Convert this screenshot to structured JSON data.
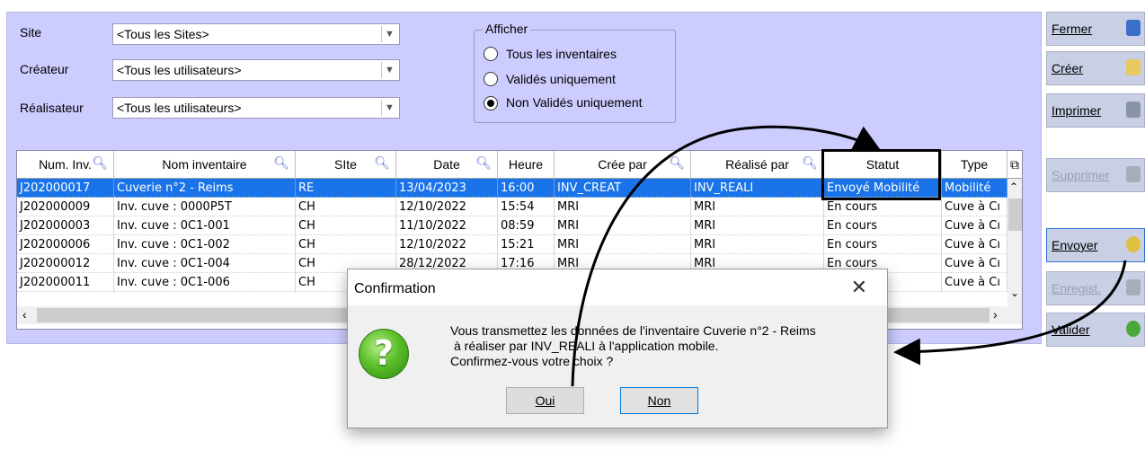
{
  "filters": {
    "site": {
      "label": "Site",
      "value": "<Tous les Sites>"
    },
    "createur": {
      "label": "Créateur",
      "value": "<Tous les utilisateurs>"
    },
    "realisateur": {
      "label": "Réalisateur",
      "value": "<Tous les utilisateurs>"
    }
  },
  "afficher": {
    "title": "Afficher",
    "options": [
      {
        "label": "Tous les inventaires",
        "selected": false
      },
      {
        "label": "Validés uniquement",
        "selected": false
      },
      {
        "label": "Non Validés uniquement",
        "selected": true
      }
    ]
  },
  "table": {
    "columns": [
      "Num. Inv.",
      "Nom inventaire",
      "SIte",
      "Date",
      "Heure",
      "Crée par",
      "Réalisé par",
      "Statut",
      "Type"
    ],
    "rows": [
      [
        "J202000017",
        "Cuverie n°2 - Reims",
        "RE",
        "13/04/2023",
        "16:00",
        "INV_CREAT",
        "INV_REALI",
        "Envoyé Mobilité",
        "Mobilité"
      ],
      [
        "J202000009",
        "Inv. cuve : 0000P5T",
        "CH",
        "12/10/2022",
        "15:54",
        "MRI",
        "MRI",
        "En cours",
        "Cuve à Cı"
      ],
      [
        "J202000003",
        "Inv. cuve : 0C1-001",
        "CH",
        "11/10/2022",
        "08:59",
        "MRI",
        "MRI",
        "En cours",
        "Cuve à Cı"
      ],
      [
        "J202000006",
        "Inv. cuve : 0C1-002",
        "CH",
        "12/10/2022",
        "15:21",
        "MRI",
        "MRI",
        "En cours",
        "Cuve à Cı"
      ],
      [
        "J202000012",
        "Inv. cuve : 0C1-004",
        "CH",
        "28/12/2022",
        "17:16",
        "MRI",
        "MRI",
        "En cours",
        "Cuve à Cı"
      ],
      [
        "J202000011",
        "Inv. cuve : 0C1-006",
        "CH",
        "",
        "",
        "",
        "",
        "",
        "Cuve à Cı"
      ]
    ],
    "selected_row": 0,
    "highlight_column": "Statut"
  },
  "buttons": {
    "fermer": "Fermer",
    "creer": "Créer",
    "imprimer": "Imprimer",
    "supprimer": "Supprimer",
    "envoyer": "Envoyer",
    "enregistrer": "Enregist.",
    "valider": "Valider"
  },
  "dialog": {
    "title": "Confirmation",
    "line1": "Vous transmettez les données de l'inventaire Cuverie n°2 - Reims",
    "line2": "à réaliser par INV_REALI à l'application mobile.",
    "line3": "Confirmez-vous votre choix ?",
    "yes": "Oui",
    "no": "Non",
    "icon": "question-icon"
  },
  "colors": {
    "panel": "#ccccff",
    "selection": "#1a73e8",
    "button": "#c9d0e6"
  }
}
